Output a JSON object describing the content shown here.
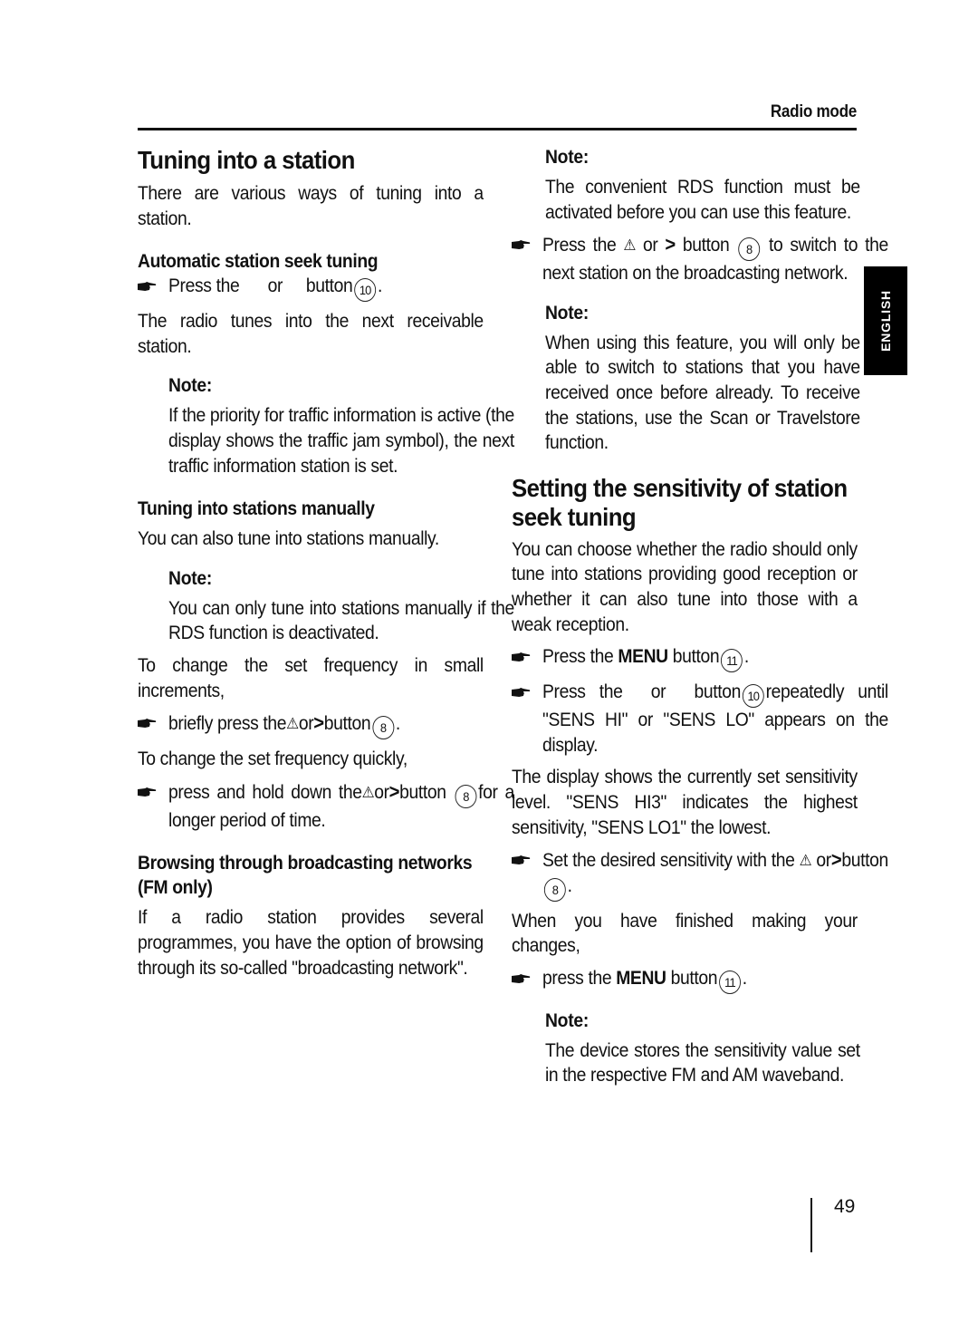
{
  "header": {
    "section": "Radio mode",
    "language_tab": "ENGLISH",
    "page_number": "49"
  },
  "left": {
    "title": "Tuning into a station",
    "intro": "There are various ways of tuning into a station.",
    "auto": {
      "heading": "Automatic station seek tuning",
      "step_pre": "Press the",
      "step_or": "or",
      "step_post": "button",
      "step_button": "10",
      "result": "The radio tunes into the next receivable station.",
      "note_label": "Note:",
      "note_text": "If the priority for traffic information is active (the display shows the traffic jam symbol), the next traffic information station is set."
    },
    "manual": {
      "heading": "Tuning into stations manually",
      "intro": "You can also tune into stations manually.",
      "note_label": "Note:",
      "note_text": "You can only tune into stations manually if the RDS function is deactivated.",
      "small_intro": "To change the set frequency in small increments,",
      "small_step_pre": "briefly press the",
      "small_step_or": "or",
      "small_step_post": "button",
      "button_8": "8",
      "quick_intro": "To change the set frequency quickly,",
      "quick_step_pre": "press and hold down the",
      "quick_step_or": "or",
      "quick_step_post": "button",
      "quick_step_tail": "for a longer period of time."
    },
    "browse": {
      "heading": "Browsing through broadcasting networks (FM only)",
      "text": "If a radio station provides several programmes, you have the option of browsing through its so-called \"broadcasting network\"."
    }
  },
  "right": {
    "note1_label": "Note:",
    "note1_text": "The convenient RDS function must be activated before you can use this feature.",
    "switch_pre": "Press the",
    "switch_or": "or",
    "switch_mid": "button",
    "switch_button": "8",
    "switch_post": "to switch to the next station on the broadcasting network.",
    "note2_label": "Note:",
    "note2_text": "When using this feature, you will only be able to switch to stations that you have received once before already. To receive the stations, use the Scan or Travelstore function.",
    "sens": {
      "title": "Setting the sensitivity of station seek tuning",
      "intro": "You can choose whether the radio should only tune into stations providing good reception or whether it can also tune into those with a weak reception.",
      "step1_pre": "Press the",
      "menu_label": "MENU",
      "step1_post": "button",
      "button_11": "11",
      "step2_pre": "Press the",
      "step2_or": "or",
      "step2_mid": "button",
      "button_10": "10",
      "step2_post": "repeatedly until \"SENS HI\" or \"SENS LO\" appears on the display.",
      "display_text": "The display shows the currently set sensitivity level. \"SENS HI3\" indicates the highest sensitivity, \"SENS LO1\" the lowest.",
      "step3_pre": "Set the desired sensitivity with the",
      "step3_or": "or",
      "step3_post": "button",
      "button_8": "8",
      "finish_text": "When you have finished making your changes,",
      "step4_pre": "press the",
      "step4_post": "button",
      "note_label": "Note:",
      "note_text": "The device stores the sensitivity value set in the respective FM and AM waveband."
    }
  }
}
